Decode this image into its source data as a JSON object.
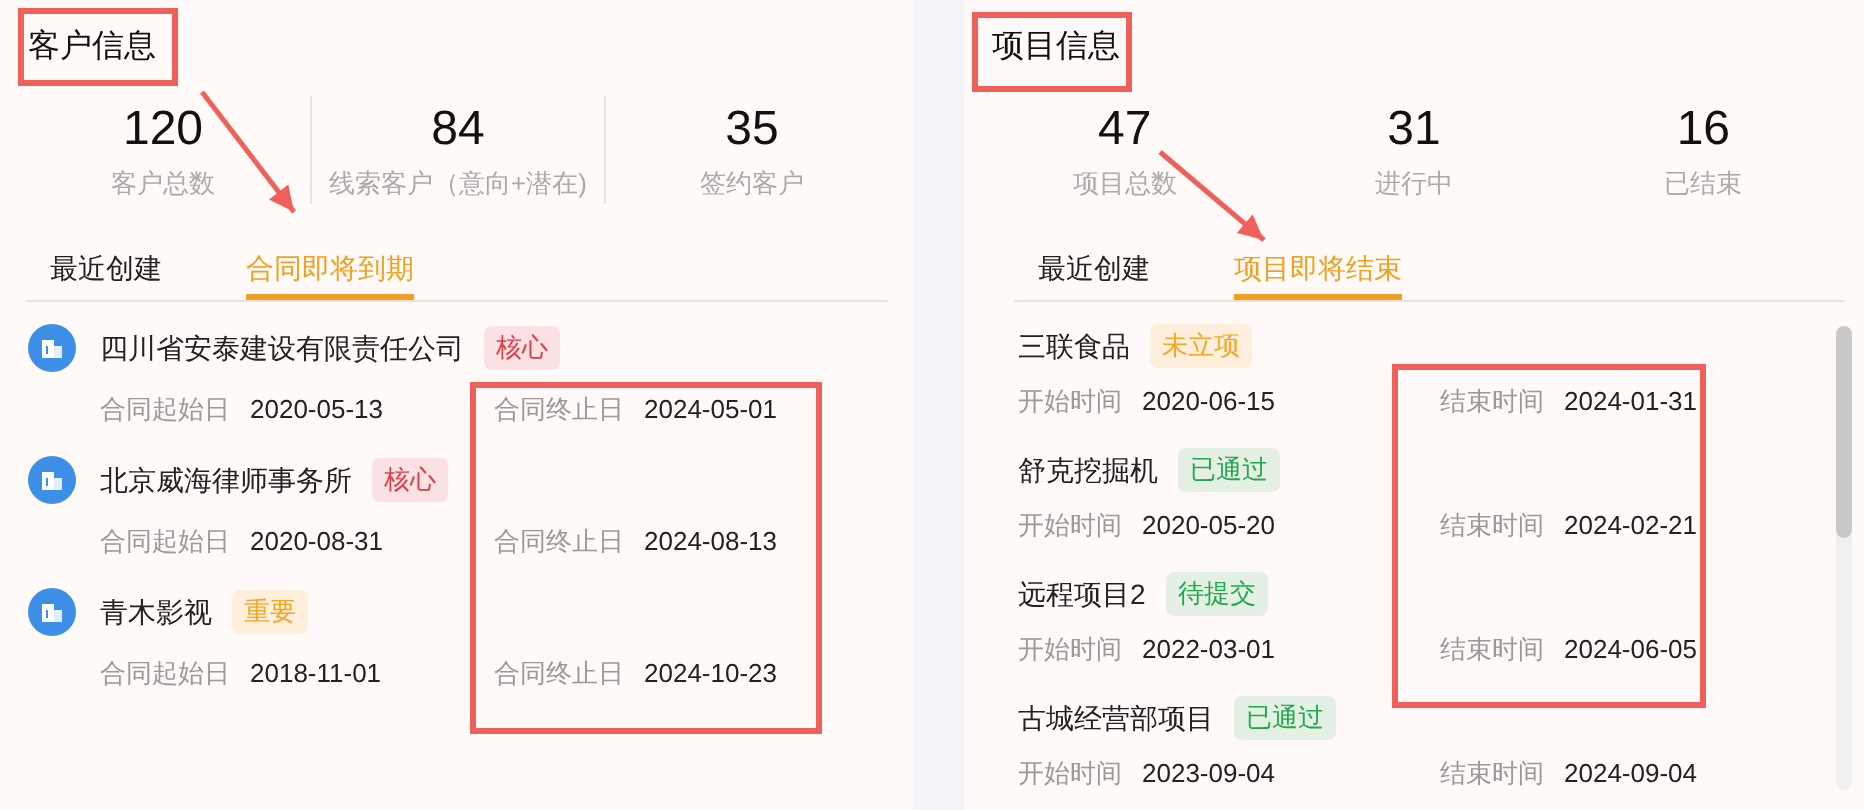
{
  "customer_panel": {
    "title": "客户信息",
    "stats": [
      {
        "value": "120",
        "label": "客户总数"
      },
      {
        "value": "84",
        "label": "线索客户（意向+潜在)"
      },
      {
        "value": "35",
        "label": "签约客户"
      }
    ],
    "tabs": [
      {
        "label": "最近创建",
        "selected": false
      },
      {
        "label": "合同即将到期",
        "selected": true
      }
    ],
    "rows": [
      {
        "kind": "customer",
        "name": "四川省安泰建设有限责任公司",
        "tag": "核心",
        "color": "#e0394a",
        "start_label": "合同起始日",
        "start": "2020-05-13",
        "end_label": "合同终止日",
        "end": "2024-05-01"
      },
      {
        "kind": "customer",
        "name": "北京威海律师事务所",
        "tag": "核心",
        "color": "#e0394a",
        "start_label": "合同起始日",
        "start": "2020-08-31",
        "end_label": "合同终止日",
        "end": "2024-08-13"
      },
      {
        "kind": "customer",
        "name": "青木影视",
        "tag": "重要",
        "color": "#f5a623",
        "start_label": "合同起始日",
        "start": "2018-11-01",
        "end_label": "合同终止日",
        "end": "2024-10-23"
      }
    ]
  },
  "project_panel": {
    "title": "项目信息",
    "stats": [
      {
        "value": "47",
        "label": "项目总数"
      },
      {
        "value": "31",
        "label": "进行中"
      },
      {
        "value": "16",
        "label": "已结束"
      }
    ],
    "tabs": [
      {
        "label": "最近创建",
        "selected": false
      },
      {
        "label": "项目即将结束",
        "selected": true
      }
    ],
    "rows": [
      {
        "kind": "project",
        "name": "三联食品",
        "tag": "未立项",
        "color": "#f5a623",
        "start_label": "开始时间",
        "start": "2020-06-15",
        "end_label": "结束时间",
        "end": "2024-01-31"
      },
      {
        "kind": "project",
        "name": "舒克挖掘机",
        "tag": "已通过",
        "color": "#22a94f",
        "start_label": "开始时间",
        "start": "2020-05-20",
        "end_label": "结束时间",
        "end": "2024-02-21"
      },
      {
        "kind": "project",
        "name": "远程项目2",
        "tag": "待提交",
        "color": "#22a94f",
        "start_label": "开始时间",
        "start": "2022-03-01",
        "end_label": "结束时间",
        "end": "2024-06-05"
      },
      {
        "kind": "project",
        "name": "古城经营部项目",
        "tag": "已通过",
        "color": "#22a94f",
        "start_label": "开始时间",
        "start": "2023-09-04",
        "end_label": "结束时间",
        "end": "2024-09-04"
      }
    ]
  }
}
